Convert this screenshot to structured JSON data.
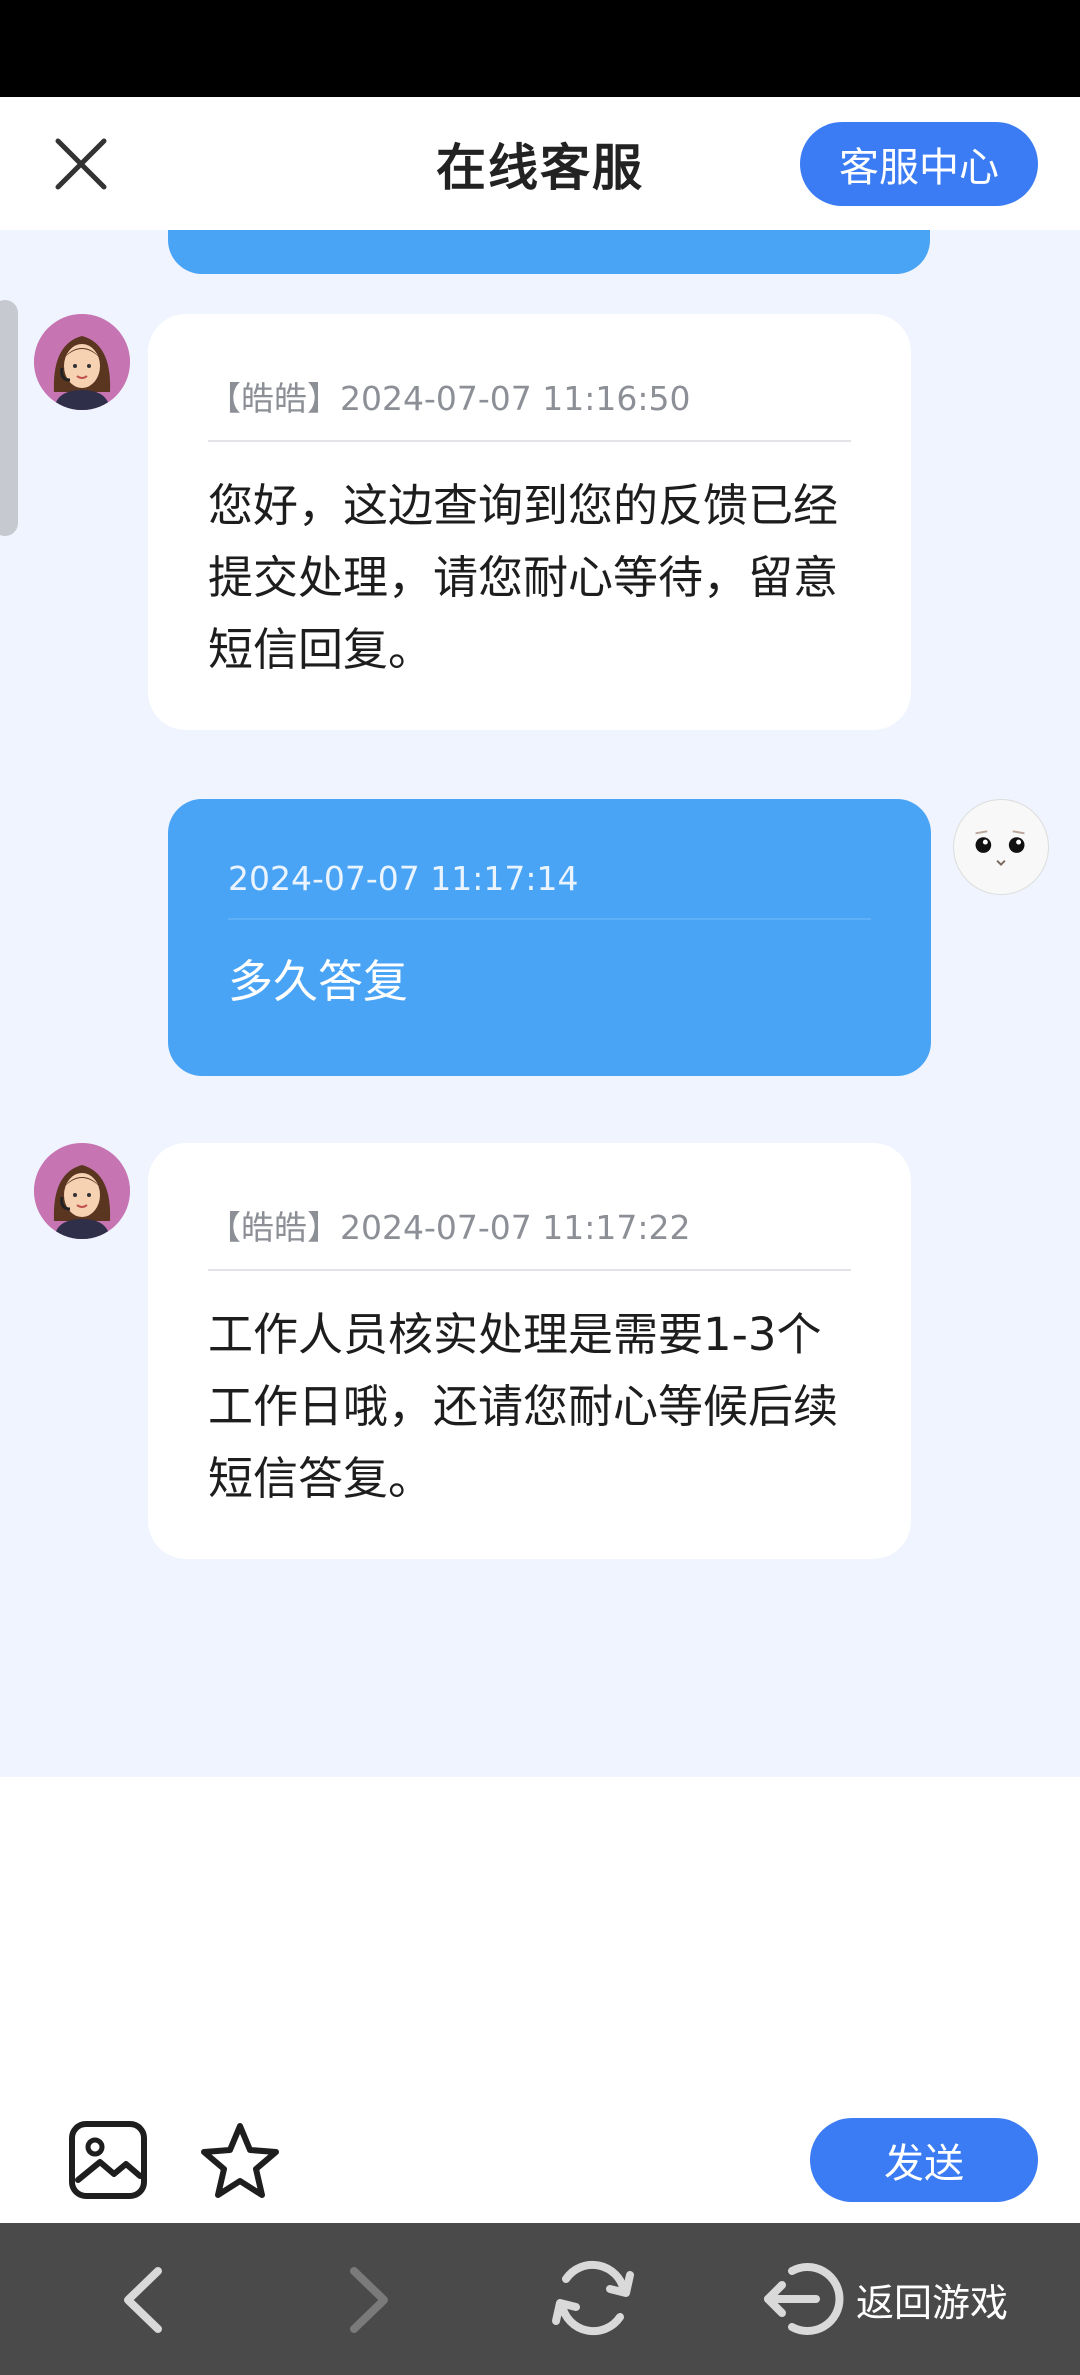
{
  "header": {
    "title": "在线客服",
    "service_center_label": "客服中心"
  },
  "messages": [
    {
      "sender": "agent",
      "agent_name": "【皓皓】",
      "timestamp": "2024-07-07 11:16:50",
      "text": "您好，这边查询到您的反馈已经提交处理，请您耐心等待，留意短信回复。"
    },
    {
      "sender": "user",
      "timestamp": "2024-07-07 11:17:14",
      "text": "多久答复"
    },
    {
      "sender": "agent",
      "agent_name": "【皓皓】",
      "timestamp": "2024-07-07 11:17:22",
      "text": "工作人员核实处理是需要1-3个工作日哦，还请您耐心等候后续短信答复。"
    }
  ],
  "toolbar": {
    "send_label": "发送",
    "icons": [
      "image-icon",
      "star-icon"
    ]
  },
  "nav": {
    "back_game_label": "返回游戏",
    "icons": [
      "chevron-left-icon",
      "chevron-right-icon",
      "refresh-icon",
      "exit-icon"
    ]
  },
  "colors": {
    "accent": "#3b7cf4",
    "user_bubble": "#4aa4f6",
    "chat_background": "#eff4fe",
    "nav_bar": "#4a4a4a"
  }
}
